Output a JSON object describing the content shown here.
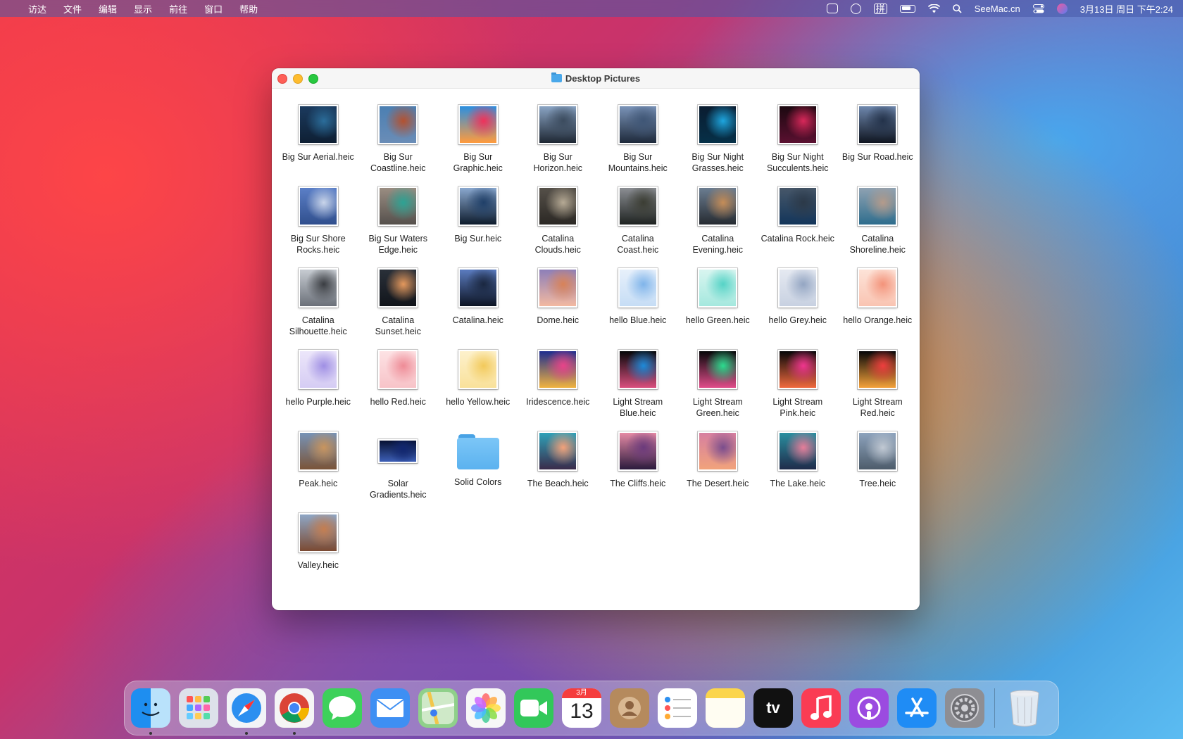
{
  "menubar": {
    "apple_glyph": "",
    "menus": [
      "访达",
      "文件",
      "编辑",
      "显示",
      "前往",
      "窗口",
      "帮助"
    ],
    "site": "SeeMac.cn",
    "input_method": "拼",
    "datetime": "3月13日 周日 下午2:24"
  },
  "window": {
    "title": "Desktop Pictures"
  },
  "files": [
    {
      "name": "Big Sur Aerial.heic",
      "kind": "image",
      "colors": [
        "#1b3a5e",
        "#2b6d9a",
        "#0e1f33"
      ]
    },
    {
      "name": "Big Sur Coastline.heic",
      "kind": "image",
      "colors": [
        "#4b7fb2",
        "#b4512f",
        "#6a8db7"
      ]
    },
    {
      "name": "Big Sur Graphic.heic",
      "kind": "image",
      "colors": [
        "#2b8fe0",
        "#f0315a",
        "#ff9b3d"
      ]
    },
    {
      "name": "Big Sur Horizon.heic",
      "kind": "image",
      "colors": [
        "#8aa4c4",
        "#3b4b5e",
        "#1e2733"
      ]
    },
    {
      "name": "Big Sur Mountains.heic",
      "kind": "image",
      "colors": [
        "#7a93b8",
        "#3f5676",
        "#1e2a3b"
      ]
    },
    {
      "name": "Big Sur Night Grasses.heic",
      "kind": "image",
      "colors": [
        "#0a1c30",
        "#1ea6df",
        "#063048"
      ]
    },
    {
      "name": "Big Sur Night Succulents.heic",
      "kind": "image",
      "colors": [
        "#1b0810",
        "#d8285a",
        "#5a1030"
      ]
    },
    {
      "name": "Big Sur Road.heic",
      "kind": "image",
      "colors": [
        "#6e87ad",
        "#23324a",
        "#0f1520"
      ]
    },
    {
      "name": "Big Sur Shore Rocks.heic",
      "kind": "image",
      "colors": [
        "#5b7fc7",
        "#c9d5ea",
        "#304f8d"
      ]
    },
    {
      "name": "Big Sur Waters Edge.heic",
      "kind": "image",
      "colors": [
        "#9a8d82",
        "#2ca394",
        "#55504c"
      ]
    },
    {
      "name": "Big Sur.heic",
      "kind": "image",
      "colors": [
        "#8aa8cf",
        "#1f3f68",
        "#0d1b2c"
      ]
    },
    {
      "name": "Catalina Clouds.heic",
      "kind": "image",
      "colors": [
        "#555049",
        "#b6aa95",
        "#2b2824"
      ]
    },
    {
      "name": "Catalina Coast.heic",
      "kind": "image",
      "colors": [
        "#8b8e93",
        "#3b3d33",
        "#1e2220"
      ]
    },
    {
      "name": "Catalina Evening.heic",
      "kind": "image",
      "colors": [
        "#6b7d91",
        "#c58d58",
        "#262b31"
      ]
    },
    {
      "name": "Catalina Rock.heic",
      "kind": "image",
      "colors": [
        "#475769",
        "#2c3948",
        "#13355a"
      ]
    },
    {
      "name": "Catalina Shoreline.heic",
      "kind": "image",
      "colors": [
        "#8fa2b2",
        "#b49b8b",
        "#2e6d8d"
      ]
    },
    {
      "name": "Catalina Silhouette.heic",
      "kind": "image",
      "colors": [
        "#c7ccd2",
        "#3a3d42",
        "#6b7079"
      ]
    },
    {
      "name": "Catalina Sunset.heic",
      "kind": "image",
      "colors": [
        "#2a3039",
        "#e5995d",
        "#11151b"
      ]
    },
    {
      "name": "Catalina.heic",
      "kind": "image",
      "colors": [
        "#5b7cc0",
        "#1a2740",
        "#0c1322"
      ]
    },
    {
      "name": "Dome.heic",
      "kind": "image",
      "colors": [
        "#8d7fb8",
        "#d88258",
        "#f3b9a1"
      ]
    },
    {
      "name": "hello Blue.heic",
      "kind": "image",
      "colors": [
        "#e7f0fb",
        "#7fb4ea",
        "#c6ddf5"
      ]
    },
    {
      "name": "hello Green.heic",
      "kind": "image",
      "colors": [
        "#d9f5f0",
        "#55d3c6",
        "#a5e8de"
      ]
    },
    {
      "name": "hello Grey.heic",
      "kind": "image",
      "colors": [
        "#e5e9f1",
        "#93a5c2",
        "#c8d1e1"
      ]
    },
    {
      "name": "hello Orange.heic",
      "kind": "image",
      "colors": [
        "#fde3d8",
        "#f3937a",
        "#f9c4b2"
      ]
    },
    {
      "name": "hello Purple.heic",
      "kind": "image",
      "colors": [
        "#ece6fa",
        "#9f8fe4",
        "#d5ccf3"
      ]
    },
    {
      "name": "hello Red.heic",
      "kind": "image",
      "colors": [
        "#fde2e4",
        "#ee8b96",
        "#f7c3c8"
      ]
    },
    {
      "name": "hello Yellow.heic",
      "kind": "image",
      "colors": [
        "#fdf1cc",
        "#f2c95a",
        "#f9e19a"
      ]
    },
    {
      "name": "Iridescence.heic",
      "kind": "image",
      "colors": [
        "#1e2d8e",
        "#e9438a",
        "#f0b340"
      ]
    },
    {
      "name": "Light Stream Blue.heic",
      "kind": "image",
      "colors": [
        "#050608",
        "#1d8ad9",
        "#d94f7e"
      ]
    },
    {
      "name": "Light Stream Green.heic",
      "kind": "image",
      "colors": [
        "#050608",
        "#2bdc8e",
        "#e04d8a"
      ]
    },
    {
      "name": "Light Stream Pink.heic",
      "kind": "image",
      "colors": [
        "#050608",
        "#f0358f",
        "#f06a3e"
      ]
    },
    {
      "name": "Light Stream Red.heic",
      "kind": "image",
      "colors": [
        "#050608",
        "#ef3e3e",
        "#f4a23a"
      ]
    },
    {
      "name": "Peak.heic",
      "kind": "image",
      "colors": [
        "#7793b6",
        "#c9955e",
        "#7a5438"
      ]
    },
    {
      "name": "Solar Gradients.heic",
      "kind": "image",
      "colors": [
        "#061132",
        "#112670",
        "#3d5fb6"
      ]
    },
    {
      "name": "Solid Colors",
      "kind": "folder",
      "colors": []
    },
    {
      "name": "The Beach.heic",
      "kind": "image",
      "colors": [
        "#2fa1b8",
        "#f4a27a",
        "#3a2b4a"
      ]
    },
    {
      "name": "The Cliffs.heic",
      "kind": "image",
      "colors": [
        "#e58aa5",
        "#6b3a7c",
        "#2b1a3d"
      ]
    },
    {
      "name": "The Desert.heic",
      "kind": "image",
      "colors": [
        "#d67fa0",
        "#7a4d8d",
        "#f1a37b"
      ]
    },
    {
      "name": "The Lake.heic",
      "kind": "image",
      "colors": [
        "#2a8fa0",
        "#e77e9a",
        "#1f2b4a"
      ]
    },
    {
      "name": "Tree.heic",
      "kind": "image",
      "colors": [
        "#8da3bd",
        "#c1c9d3",
        "#4d5c6b"
      ]
    },
    {
      "name": "Valley.heic",
      "kind": "image",
      "colors": [
        "#8fa7c6",
        "#c57e50",
        "#7b4a32"
      ]
    }
  ],
  "dock": {
    "calendar_month": "3月",
    "calendar_day": "13",
    "tv_label": "tv",
    "apps": [
      {
        "name": "finder",
        "bg": "#3a9ff5",
        "running": true
      },
      {
        "name": "launchpad",
        "bg": "#dde1ea",
        "running": false
      },
      {
        "name": "safari",
        "bg": "#f2f4f7",
        "running": true
      },
      {
        "name": "chrome",
        "bg": "#f5f5f5",
        "running": true
      },
      {
        "name": "messages",
        "bg": "#3dd15a",
        "running": false
      },
      {
        "name": "mail",
        "bg": "#3e8ff3",
        "running": false
      },
      {
        "name": "maps",
        "bg": "#8fd08a",
        "running": false
      },
      {
        "name": "photos",
        "bg": "#f7f7f7",
        "running": false
      },
      {
        "name": "facetime",
        "bg": "#32c85a",
        "running": false
      },
      {
        "name": "calendar",
        "bg": "#ffffff",
        "running": false
      },
      {
        "name": "contacts",
        "bg": "#b58a5d",
        "running": false
      },
      {
        "name": "reminders",
        "bg": "#ffffff",
        "running": false
      },
      {
        "name": "notes",
        "bg": "#fbd54c",
        "running": false
      },
      {
        "name": "tv",
        "bg": "#111111",
        "running": false
      },
      {
        "name": "music",
        "bg": "#fa3c54",
        "running": false
      },
      {
        "name": "podcasts",
        "bg": "#9b4be0",
        "running": false
      },
      {
        "name": "app-store",
        "bg": "#1f8cf5",
        "running": false
      },
      {
        "name": "system-preferences",
        "bg": "#8e8e93",
        "running": false
      }
    ]
  }
}
